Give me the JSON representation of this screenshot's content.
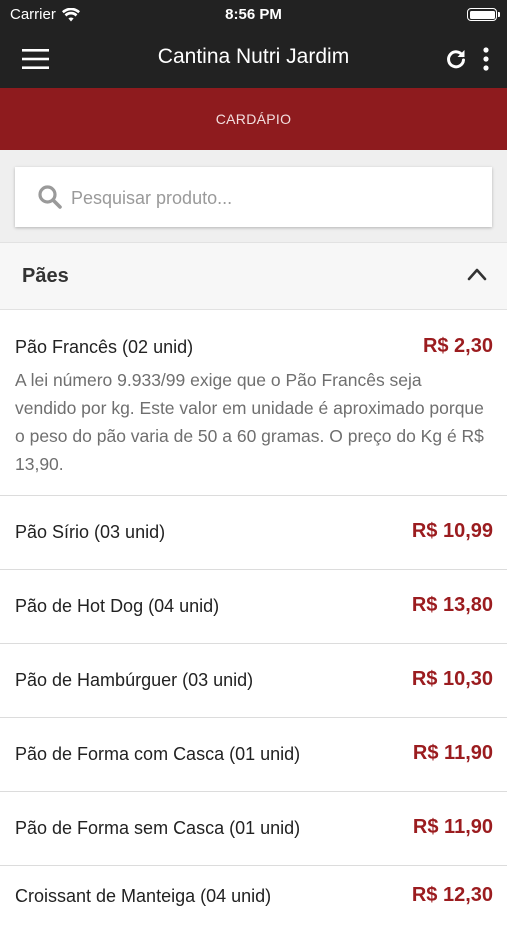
{
  "status_bar": {
    "carrier": "Carrier",
    "time": "8:56 PM"
  },
  "nav": {
    "title": "Cantina Nutri Jardim"
  },
  "tab": {
    "label": "CARDÁPIO"
  },
  "search": {
    "placeholder": "Pesquisar produto..."
  },
  "category": {
    "title": "Pães"
  },
  "products": [
    {
      "name": "Pão Francês (02 unid)",
      "price": "R$ 2,30",
      "description": "A lei número 9.933/99 exige que o Pão Francês seja vendido por kg. Este valor em unidade é aproximado porque o peso do pão varia de 50 a 60 gramas. O preço do Kg é R$ 13,90."
    },
    {
      "name": "Pão Sírio (03 unid)",
      "price": "R$ 10,99"
    },
    {
      "name": "Pão de Hot Dog (04 unid)",
      "price": "R$ 13,80"
    },
    {
      "name": "Pão de Hambúrguer (03 unid)",
      "price": "R$ 10,30"
    },
    {
      "name": "Pão de Forma com Casca (01 unid)",
      "price": "R$ 11,90"
    },
    {
      "name": "Pão de Forma sem Casca (01 unid)",
      "price": "R$ 11,90"
    },
    {
      "name": "Croissant de Manteiga (04 unid)",
      "price": "R$ 12,30"
    }
  ],
  "colors": {
    "header_bg": "#222222",
    "tab_bg": "#8e1b1e",
    "price": "#9b1c1f"
  }
}
